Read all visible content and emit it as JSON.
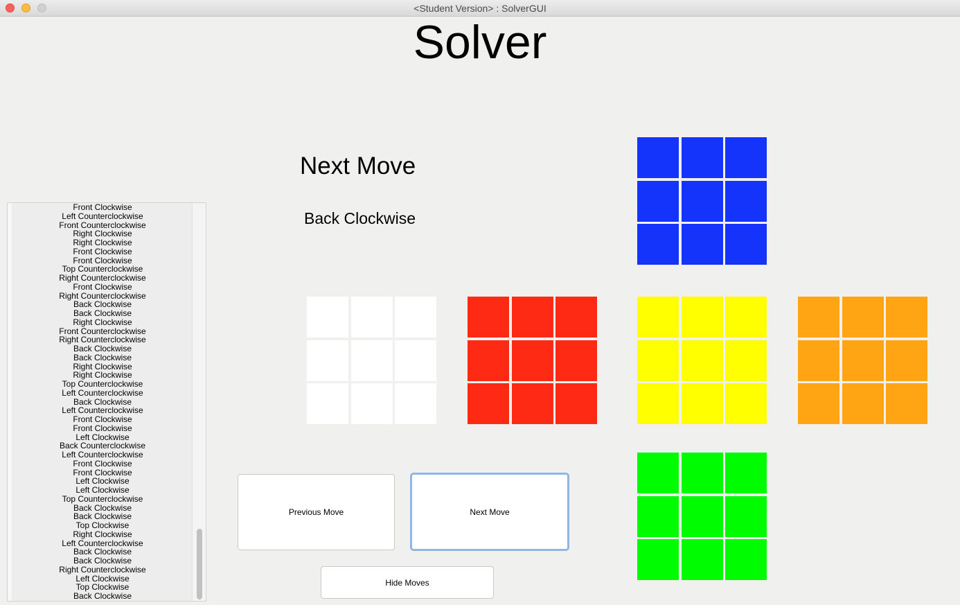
{
  "window": {
    "title": "<Student Version> : SolverGUI"
  },
  "header": {
    "title": "Solver"
  },
  "next_move": {
    "heading": "Next Move",
    "current": "Back Clockwise"
  },
  "moves": [
    "Front Clockwise",
    "Left Counterclockwise",
    "Front Counterclockwise",
    "Right Clockwise",
    "Right Clockwise",
    "Front Clockwise",
    "Front Clockwise",
    "Top Counterclockwise",
    "Right Counterclockwise",
    "Front Clockwise",
    "Right Counterclockwise",
    "Back Clockwise",
    "Back Clockwise",
    "Right Clockwise",
    "Front Counterclockwise",
    "Right Counterclockwise",
    "Back Clockwise",
    "Back Clockwise",
    "Right Clockwise",
    "Right Clockwise",
    "Top Counterclockwise",
    "Left Counterclockwise",
    "Back Clockwise",
    "Left Counterclockwise",
    "Front Clockwise",
    "Front Clockwise",
    "Left Clockwise",
    "Back Counterclockwise",
    "Left Counterclockwise",
    "Front Clockwise",
    "Front Clockwise",
    "Left Clockwise",
    "Left Clockwise",
    "Top Counterclockwise",
    "Back Clockwise",
    "Back Clockwise",
    "Top Clockwise",
    "Right Clockwise",
    "Left Counterclockwise",
    "Back Clockwise",
    "Back Clockwise",
    "Right Counterclockwise",
    "Left Clockwise",
    "Top Clockwise",
    "Back Clockwise"
  ],
  "cube": {
    "top": "#1434fc",
    "left": "#ffffff",
    "front": "#ff2a14",
    "right": "#ffff00",
    "back": "#ffa514",
    "bottom": "#00fc00"
  },
  "buttons": {
    "previous": "Previous Move",
    "next": "Next Move",
    "hide": "Hide Moves"
  }
}
